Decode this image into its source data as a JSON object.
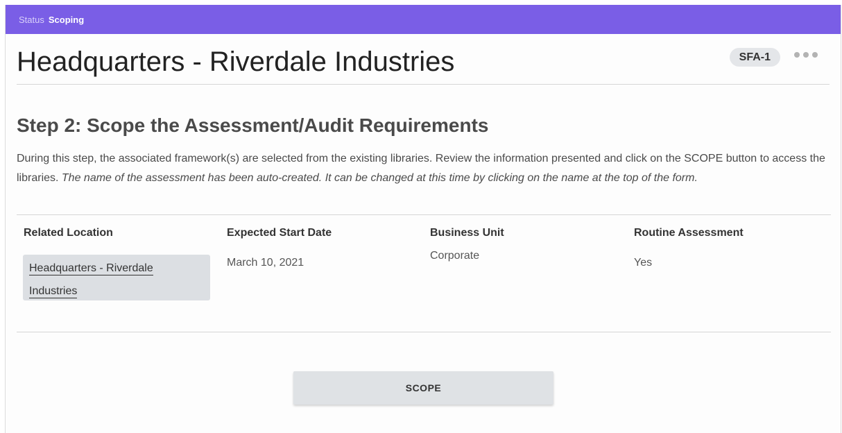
{
  "status": {
    "label": "Status",
    "value": "Scoping",
    "bar_color": "#7a5ee6"
  },
  "header": {
    "title": "Headquarters - Riverdale Industries",
    "badge": "SFA-1",
    "more_icon": "more-horizontal-icon"
  },
  "step": {
    "heading": "Step 2: Scope the Assessment/Audit Requirements",
    "description_plain": "During this step, the associated framework(s) are selected from the existing libraries. Review the information presented and click on the SCOPE button to access the libraries. ",
    "description_italic": "The name of the assessment has been auto-created. It can be changed at this time by clicking on the name at the top of the form."
  },
  "fields": {
    "related_location": {
      "label": "Related Location",
      "value_line1": "Headquarters - Riverdale",
      "value_line2": "Industries"
    },
    "expected_start_date": {
      "label": "Expected Start Date",
      "value": "March 10, 2021"
    },
    "business_unit": {
      "label": "Business Unit",
      "value": "Corporate"
    },
    "routine_assessment": {
      "label": "Routine Assessment",
      "value": "Yes"
    }
  },
  "actions": {
    "scope_label": "SCOPE"
  }
}
